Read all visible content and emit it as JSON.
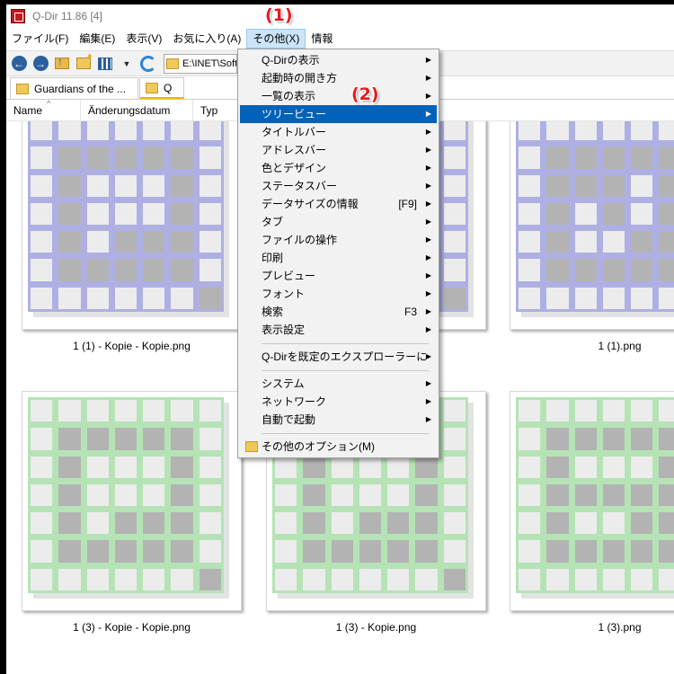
{
  "window": {
    "title": "Q-Dir 11.86 [4]"
  },
  "menubar": [
    "ファイル(F)",
    "編集(E)",
    "表示(V)",
    "お気に入り(A)",
    "その他(X)",
    "情報"
  ],
  "toolbar": {
    "address": "E:\\INET\\Soft"
  },
  "tabs": [
    "Guardians of the ...",
    "Q"
  ],
  "columns": [
    "Name",
    "Änderungsdatum",
    "Typ"
  ],
  "thumbnails": [
    {
      "label": "1 (1) - Kopie - Kopie.png",
      "color": "#aeb0e3"
    },
    {
      "label": "",
      "color": "#aeb0e3"
    },
    {
      "label": "1 (1).png",
      "color": "#aeb0e3"
    },
    {
      "label": "1 (3) - Kopie - Kopie.png",
      "color": "#b5e3b5"
    },
    {
      "label": "1 (3) - Kopie.png",
      "color": "#b5e3b5"
    },
    {
      "label": "1 (3).png",
      "color": "#b5e3b5"
    }
  ],
  "context_menu": {
    "items": [
      {
        "label": "Q-Dirの表示",
        "submenu": true
      },
      {
        "label": "起動時の開き方",
        "submenu": true
      },
      {
        "label": "一覧の表示",
        "submenu": true
      },
      {
        "label": "ツリービュー",
        "submenu": true,
        "highlighted": true
      },
      {
        "label": "タイトルバー",
        "submenu": true
      },
      {
        "label": "アドレスバー",
        "submenu": true
      },
      {
        "label": "色とデザイン",
        "submenu": true
      },
      {
        "label": "ステータスバー",
        "submenu": true
      },
      {
        "label": "データサイズの情報",
        "shortcut": "[F9]",
        "submenu": true
      },
      {
        "label": "タブ",
        "submenu": true
      },
      {
        "label": "ファイルの操作",
        "submenu": true
      },
      {
        "label": "印刷",
        "submenu": true
      },
      {
        "label": "プレビュー",
        "submenu": true
      },
      {
        "label": "フォント",
        "submenu": true
      },
      {
        "label": "検索",
        "shortcut": "F3",
        "submenu": true
      },
      {
        "label": "表示設定",
        "submenu": true
      },
      {
        "label": "Q-Dirを既定のエクスプローラーに",
        "submenu": true
      },
      {
        "label": "システム",
        "submenu": true
      },
      {
        "label": "ネットワーク",
        "submenu": true
      },
      {
        "label": "自動で起動",
        "submenu": true
      },
      {
        "label": "その他のオプション(M)",
        "submenu": false
      }
    ]
  },
  "annotations": [
    "(1)",
    "(2)"
  ]
}
